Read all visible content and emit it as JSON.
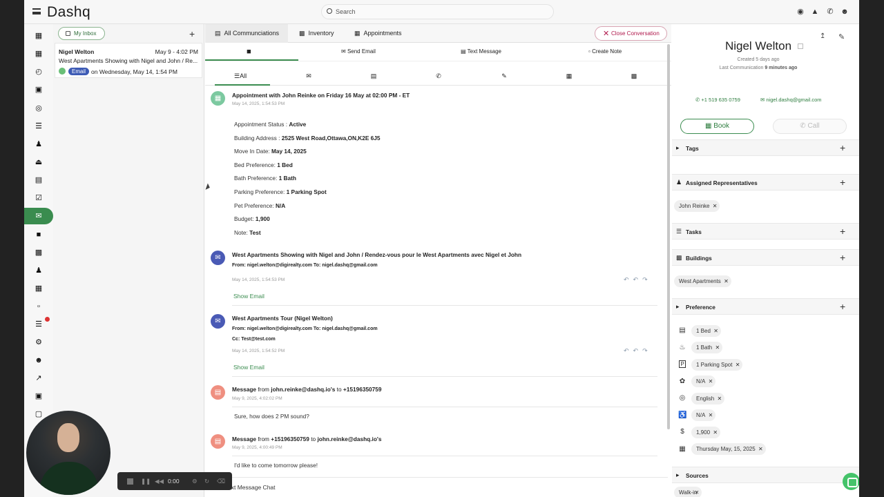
{
  "app": {
    "logo": "Dashq"
  },
  "search": {
    "placeholder": "Search"
  },
  "inbox": {
    "my_inbox": "My Inbox",
    "card": {
      "name": "Nigel Welton",
      "date": "May 9 - 4:02 PM",
      "subject": "West Apartments Showing with Nigel and John / Re...",
      "badge": "Email",
      "when": "on Wednesday, May 14, 1:54 PM"
    }
  },
  "tabs": [
    {
      "label": "All Communciations"
    },
    {
      "label": "Inventory"
    },
    {
      "label": "Appointments"
    }
  ],
  "close_conversation": "Close Conversation",
  "actions": {
    "send_email": "Send Email",
    "text_message": "Text Message",
    "create_note": "Create Note"
  },
  "filters": {
    "all": "All"
  },
  "feed": {
    "appt": {
      "title": "Appointment with John Reinke on Friday 16 May at 02:00 PM - ET",
      "time": "May 14, 2025, 1:54:53 PM",
      "lines": [
        {
          "label": "Appointment Status : ",
          "value": "Active"
        },
        {
          "label": "Building Address : ",
          "value": "2525 West Road,Ottawa,ON,K2E 6J5"
        },
        {
          "label": "Move In Date: ",
          "value": "May 14, 2025"
        },
        {
          "label": "Bed Preference: ",
          "value": "1 Bed"
        },
        {
          "label": "Bath Preference: ",
          "value": "1 Bath"
        },
        {
          "label": "Parking Preference: ",
          "value": "1 Parking Spot"
        },
        {
          "label": "Pet Preference: ",
          "value": "N/A"
        },
        {
          "label": "Budget: ",
          "value": "1,900"
        },
        {
          "label": "Note: ",
          "value": "Test"
        }
      ]
    },
    "email1": {
      "title": "West Apartments Showing with Nigel and John / Rendez-vous pour le West Apartments avec Nigel et John",
      "from": "From: nigel.welton@digirealty.com To: nigel.dashq@gmail.com",
      "time": "May 14, 2025, 1:54:53 PM",
      "show": "Show Email"
    },
    "email2": {
      "title": "West Apartments Tour (Nigel Welton)",
      "from": "From: nigel.welton@digirealty.com To: nigel.dashq@gmail.com",
      "cc": "Cc: Test@test.com",
      "time": "May 14, 2025, 1:54:52 PM",
      "show": "Show Email"
    },
    "msg1": {
      "prefix": "Message",
      "from_word": "from",
      "from": "john.reinke@dashq.io's",
      "to_word": "to",
      "to": "+15196350759",
      "time": "May 9, 2025, 4:02:02 PM",
      "body": "Sure, how does 2 PM sound?"
    },
    "msg2": {
      "prefix": "Message",
      "from_word": "from",
      "from": "+15196350759",
      "to_word": "to",
      "to": "john.reinke@dashq.io's",
      "time": "May 9, 2025, 4:00:49 PM",
      "body": "I'd like to come tomorrow please!"
    }
  },
  "bottom_text": "ext Message Chat",
  "recorder": {
    "time": "0:00"
  },
  "contact": {
    "name": "Nigel Welton",
    "created": "Created 5 days ago",
    "last_comm": "Last Communication",
    "last_comm_value": "9 minutes ago",
    "phone": "+1 519 635 0759",
    "email": "nigel.dashq@gmail.com",
    "book": "Book",
    "call": "Call"
  },
  "sections": {
    "tags": "Tags",
    "reps": "Assigned Representatives",
    "rep_chip": "John Reinke",
    "tasks": "Tasks",
    "buildings": "Buildings",
    "building_chip": "West Apartments",
    "preference": "Preference",
    "prefs": [
      "1 Bed",
      "1 Bath",
      "1 Parking Spot",
      "N/A",
      "English",
      "N/A",
      "1,900",
      "Thursday May, 15, 2025"
    ],
    "sources": "Sources",
    "source_chip": "Walk-in"
  },
  "colors": {
    "accent": "#3a8c4f",
    "email_badge": "#3d5bb5",
    "danger": "#b0184c",
    "appt_avatar": "#7cc9a0",
    "email_avatar": "#4a5ab5",
    "msg_avatar": "#ef8f80"
  }
}
